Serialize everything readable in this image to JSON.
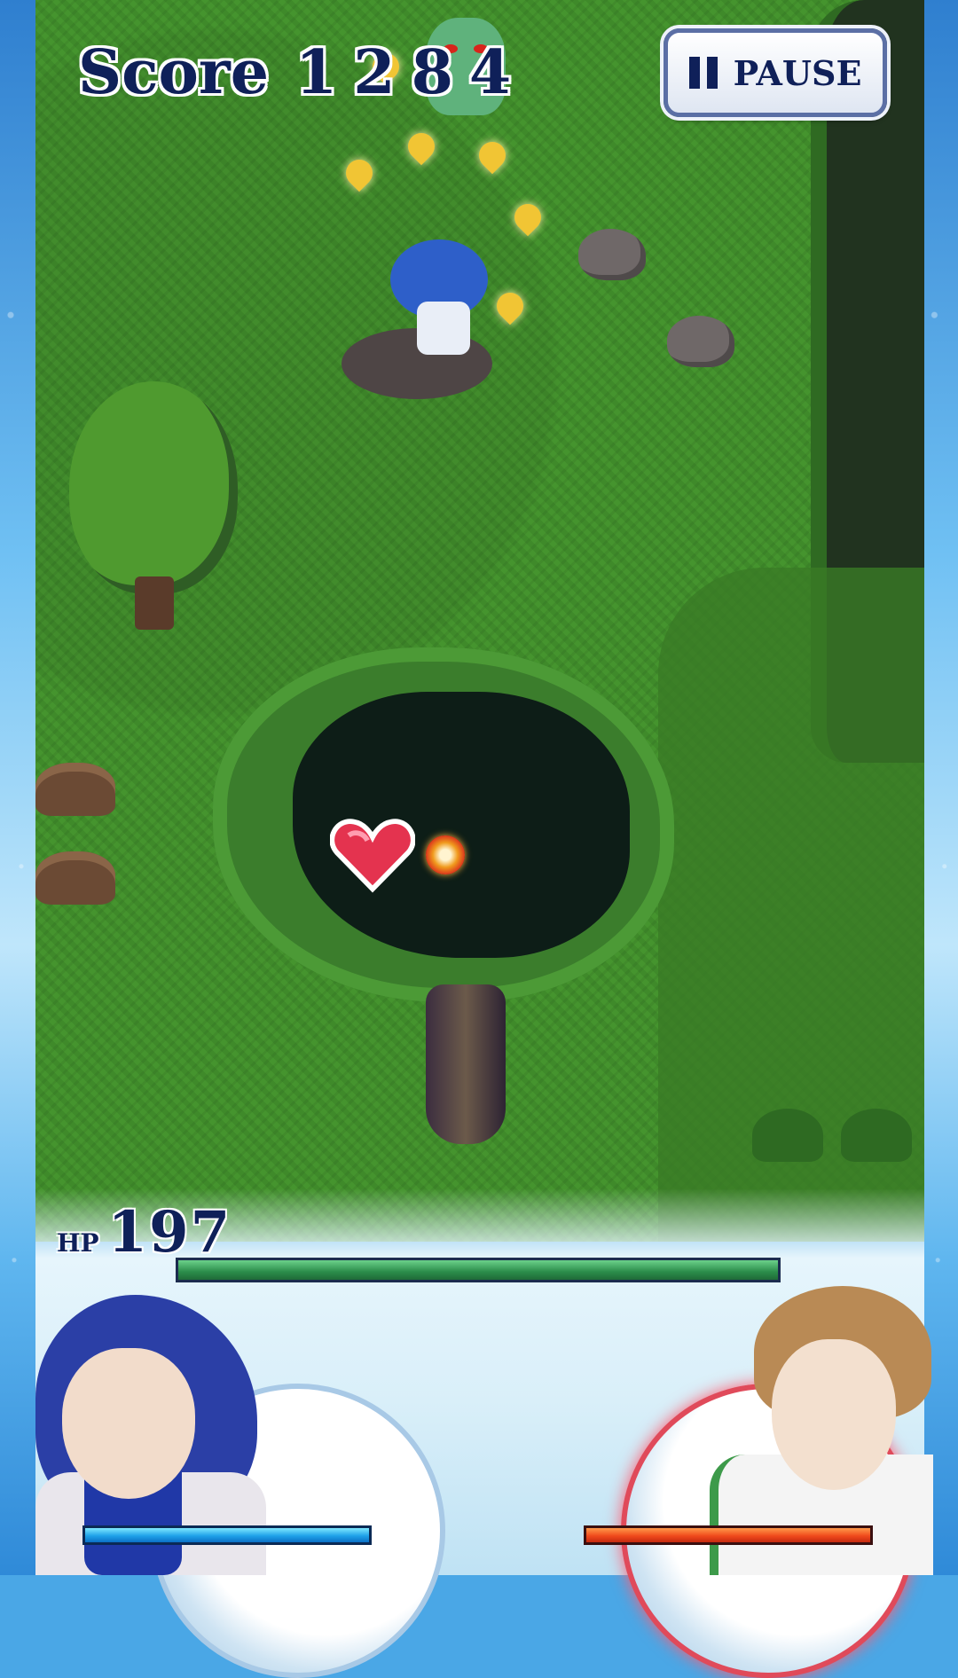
{
  "hud": {
    "score_label": "Score",
    "score_value": "1284",
    "pause_label": "PAUSE"
  },
  "status": {
    "hp_prefix": "HP",
    "hp_value": "197",
    "hp_fill_percent": 100
  },
  "items": {
    "heart": "heart-icon",
    "orb": "fire-orb-icon"
  },
  "colors": {
    "hp_bar": "#2b8c4a",
    "left_gauge": "#1ea2e8",
    "right_gauge": "#f04a1c",
    "text": "#0f2059"
  }
}
